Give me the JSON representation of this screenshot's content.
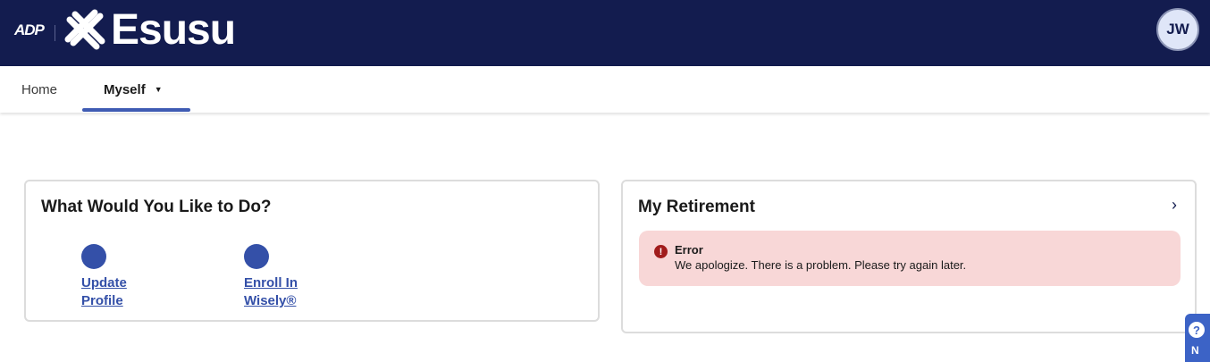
{
  "header": {
    "adp_logo_text": "ADP",
    "brand_name": "Esusu",
    "avatar_initials": "JW",
    "background_color": "#131c4f"
  },
  "nav": {
    "tabs": [
      {
        "label": "Home",
        "active": false
      },
      {
        "label": "Myself",
        "active": true,
        "has_dropdown": true
      }
    ],
    "accent_color": "#3f5bb3"
  },
  "actions_card": {
    "title": "What Would You Like to Do?",
    "actions": [
      {
        "label": "Update Profile",
        "icon": "action-circle-icon"
      },
      {
        "label": "Enroll In Wisely®",
        "icon": "action-circle-icon"
      }
    ]
  },
  "retirement_card": {
    "title": "My Retirement",
    "chevron_icon": "chevron-right-icon",
    "error": {
      "icon": "error-icon",
      "title": "Error",
      "message": "We apologize. There is a problem. Please try again later.",
      "background_color": "#f8d7d7"
    }
  },
  "help_tab": {
    "icon": "help-icon",
    "label": "N"
  }
}
